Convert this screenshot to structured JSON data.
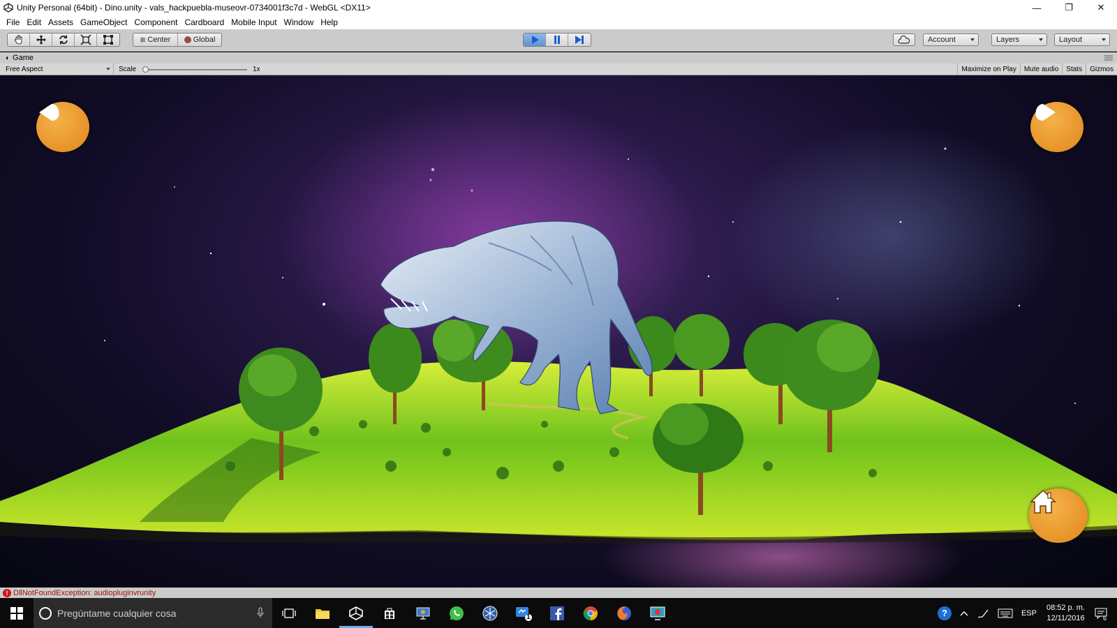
{
  "window": {
    "title": "Unity Personal (64bit) - Dino.unity - vals_hackpuebla-museovr-0734001f3c7d - WebGL <DX11>",
    "minimize": "—",
    "maximize": "❐",
    "close": "✕"
  },
  "menu": [
    "File",
    "Edit",
    "Assets",
    "GameObject",
    "Component",
    "Cardboard",
    "Mobile Input",
    "Window",
    "Help"
  ],
  "toolbar": {
    "pivot_label": "Center",
    "space_label": "Global",
    "account_label": "Account",
    "layers_label": "Layers",
    "layout_label": "Layout"
  },
  "game_view": {
    "tab_label": "Game",
    "aspect": "Free Aspect",
    "scale_label": "Scale",
    "scale_value": "1x",
    "scale_fraction": 0.0,
    "maximize_on_play": "Maximize on Play",
    "mute_audio": "Mute audio",
    "stats": "Stats",
    "gizmos": "Gizmos"
  },
  "scene": {
    "prev_icon": "arrow-left-icon",
    "next_icon": "arrow-right-icon",
    "home_icon": "home-icon"
  },
  "console": {
    "error_text": "DllNotFoundException: audiopluginvrunity",
    "error_glyph": "!"
  },
  "taskbar": {
    "search_placeholder": "Pregúntame cualquier cosa",
    "language": "ESP",
    "time": "08:52 p. m.",
    "date": "12/11/2016",
    "notification_count": "6",
    "messenger_badge": "1",
    "help_glyph": "?"
  }
}
